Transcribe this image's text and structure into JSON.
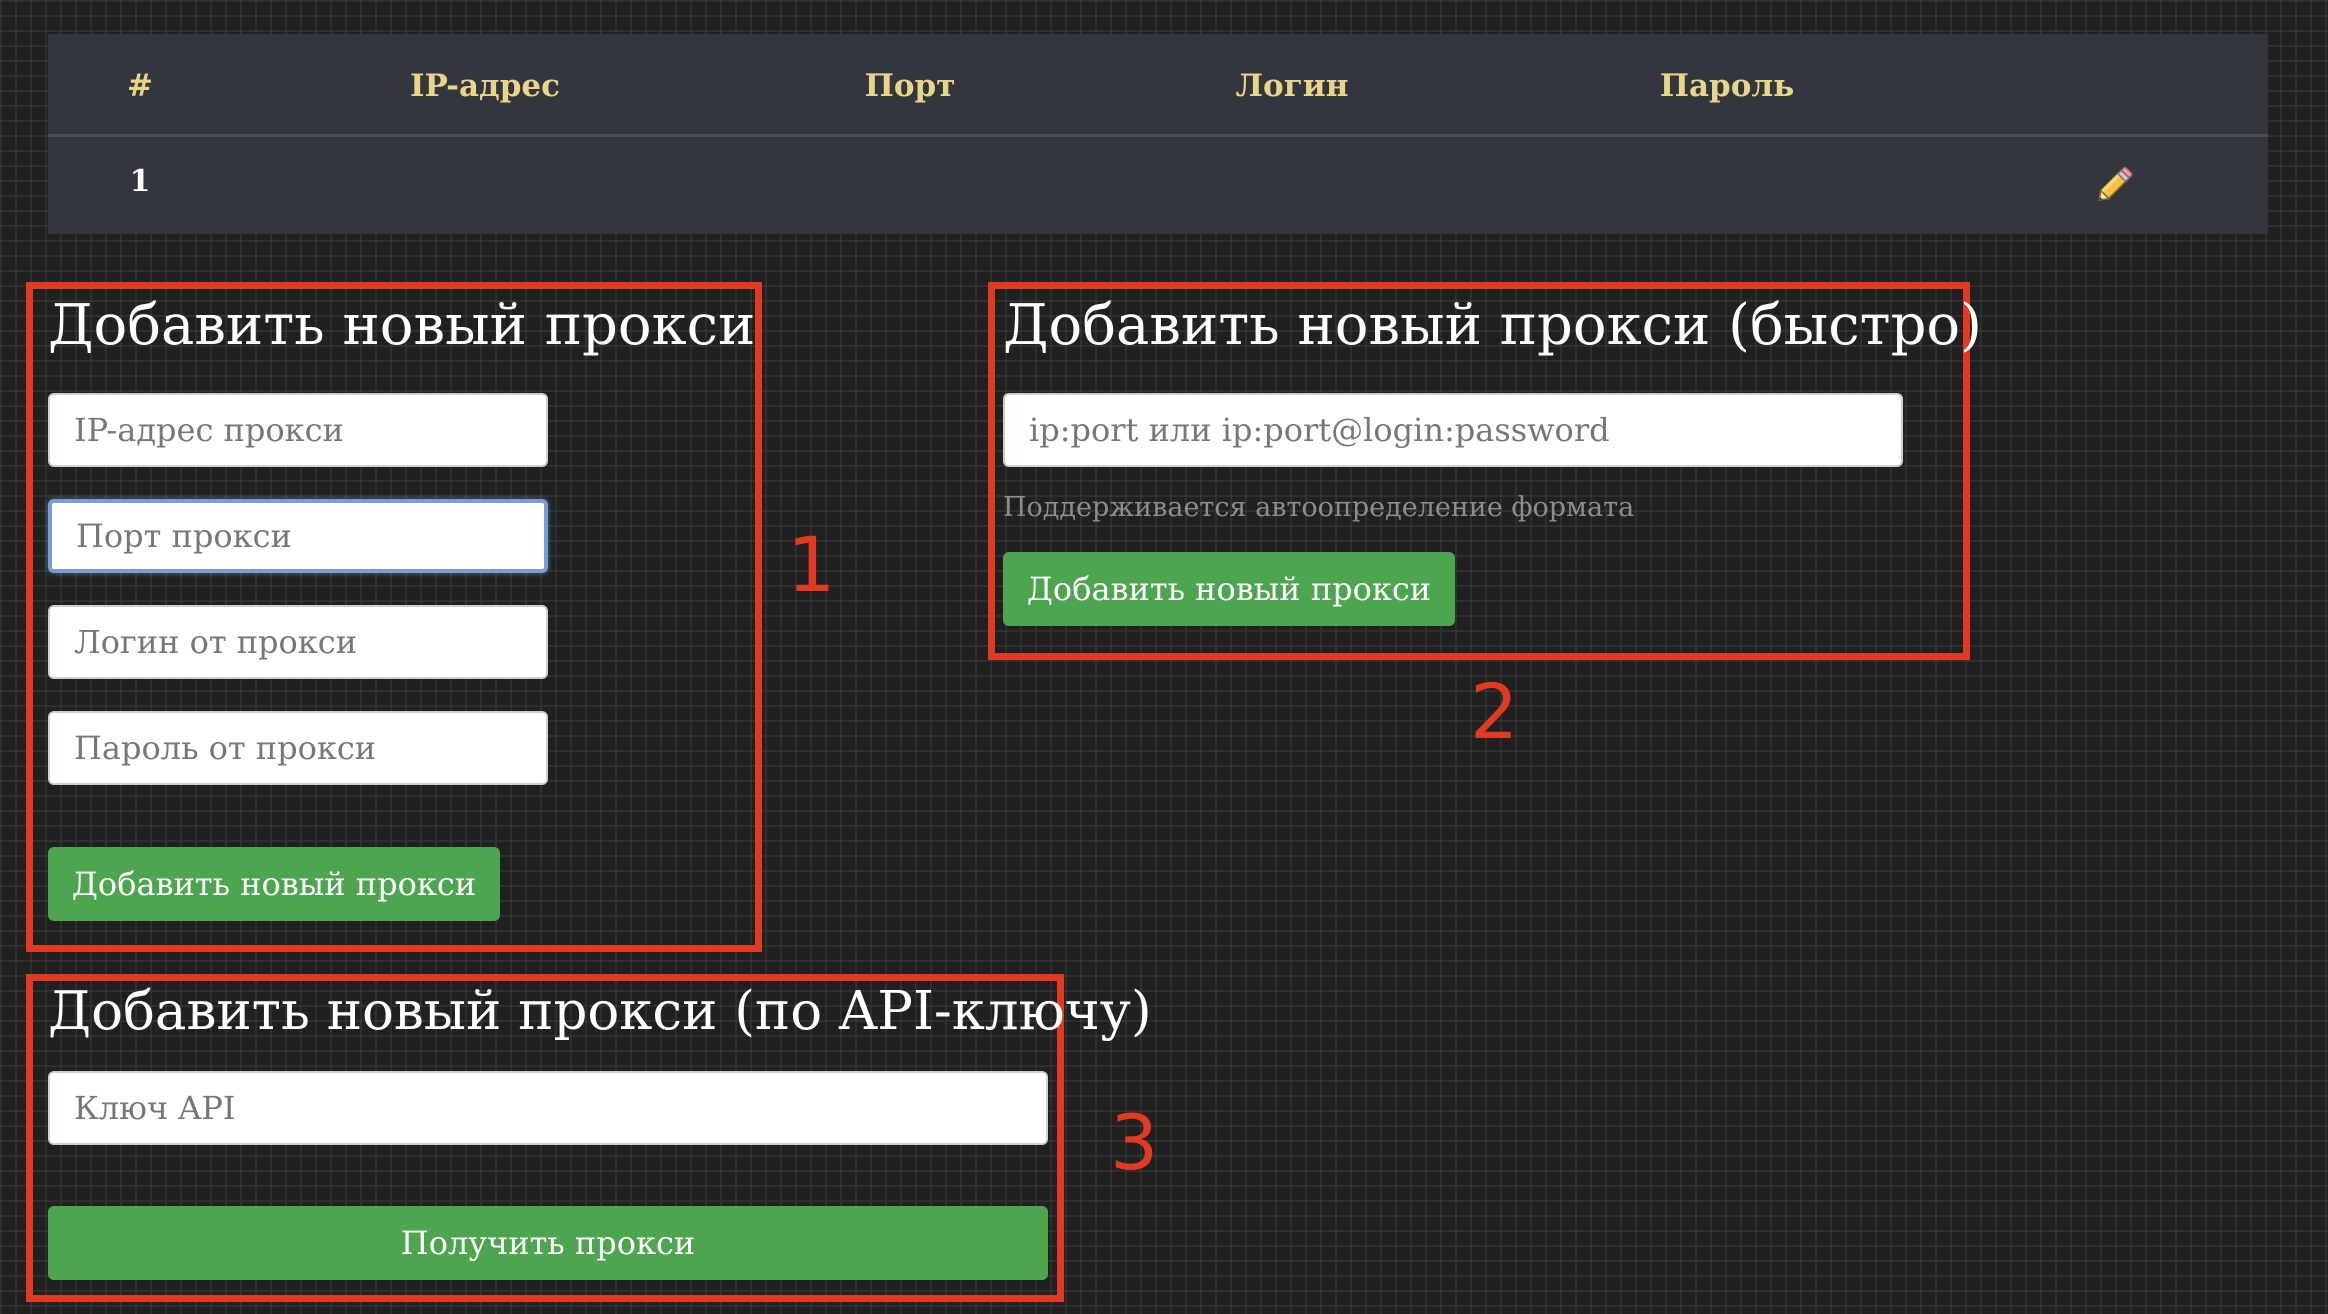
{
  "table": {
    "headers": {
      "num": "#",
      "ip": "IP-адрес",
      "port": "Порт",
      "login": "Логин",
      "password": "Пароль"
    },
    "rows": [
      {
        "num": "1",
        "ip": "",
        "port": "",
        "login": "",
        "password": "",
        "action_icon": "pencil-icon"
      }
    ]
  },
  "form_manual": {
    "annotation_number": "1",
    "title": "Добавить новый прокси",
    "ip_placeholder": "IP-адрес прокси",
    "port_placeholder": "Порт прокси",
    "login_placeholder": "Логин от прокси",
    "password_placeholder": "Пароль от прокси",
    "submit_label": "Добавить новый прокси"
  },
  "form_quick": {
    "annotation_number": "2",
    "title": "Добавить новый прокси (быстро)",
    "input_placeholder": "ip:port или ip:port@login:password",
    "help_text": "Поддерживается автоопределение формата",
    "submit_label": "Добавить новый прокси"
  },
  "form_api": {
    "annotation_number": "3",
    "title": "Добавить новый прокси (по API-ключу)",
    "key_placeholder": "Ключ API",
    "submit_label": "Получить прокси"
  },
  "colors": {
    "background": "#202020",
    "table_bg": "#33363c",
    "header_text": "#e8d48a",
    "button_green": "#4ea54f",
    "annotation_red": "#e03a22",
    "focus_border": "#7d9bd0"
  }
}
